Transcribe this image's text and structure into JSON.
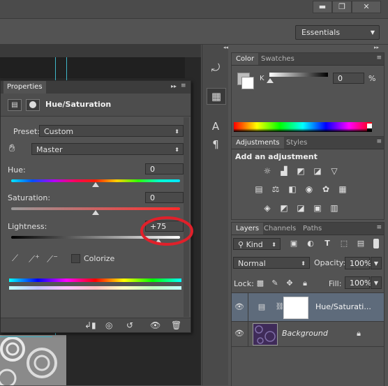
{
  "window": {
    "minimize": "▬",
    "restore": "❐",
    "close": "✕"
  },
  "workspace": {
    "label": "Essentials"
  },
  "properties": {
    "tab": "Properties",
    "title": "Hue/Saturation",
    "preset_label": "Preset:",
    "preset_value": "Custom",
    "channel_value": "Master",
    "hue_label": "Hue:",
    "hue_value": "0",
    "saturation_label": "Saturation:",
    "saturation_value": "0",
    "lightness_label": "Lightness:",
    "lightness_value": "+75",
    "colorize_label": "Colorize"
  },
  "color_panel": {
    "tabs": [
      "Color",
      "Swatches"
    ],
    "channel_label": "K",
    "k_value": "0",
    "unit": "%"
  },
  "adjustments_panel": {
    "tabs": [
      "Adjustments",
      "Styles"
    ],
    "heading": "Add an adjustment"
  },
  "layers_panel": {
    "tabs": [
      "Layers",
      "Channels",
      "Paths"
    ],
    "filter": "Kind",
    "blend_mode": "Normal",
    "opacity_label": "Opacity:",
    "opacity_value": "100%",
    "lock_label": "Lock:",
    "fill_label": "Fill:",
    "fill_value": "100%",
    "layers": [
      {
        "name": "Hue/Saturati..."
      },
      {
        "name": "Background"
      }
    ]
  },
  "colors": {
    "annotation_circle": "#e0202a",
    "accent_guide": "#3fb7c9"
  }
}
